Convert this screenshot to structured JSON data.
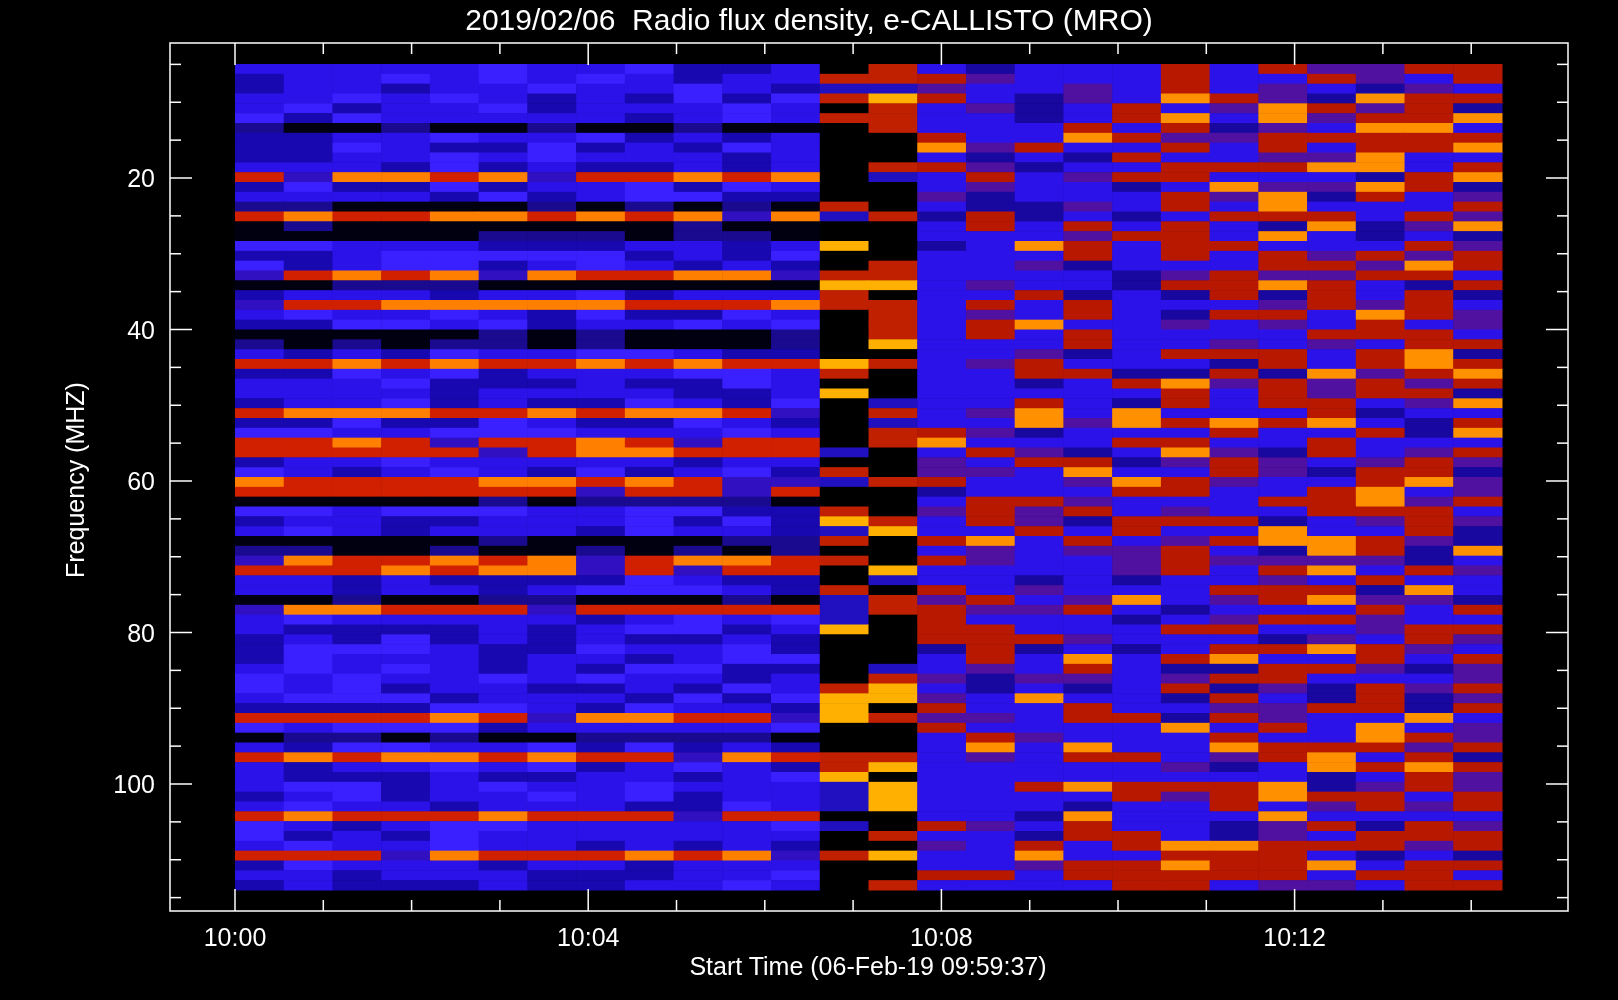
{
  "title": "2019/02/06  Radio flux density, e-CALLISTO (MRO)",
  "y_axis": {
    "label": "Frequency (MHZ)",
    "ticks": [
      "20",
      "40",
      "60",
      "80",
      "100"
    ]
  },
  "x_axis": {
    "label": "Start Time (06-Feb-19 09:59:37)",
    "ticks": [
      "10:00",
      "10:04",
      "10:08",
      "10:12"
    ]
  }
}
